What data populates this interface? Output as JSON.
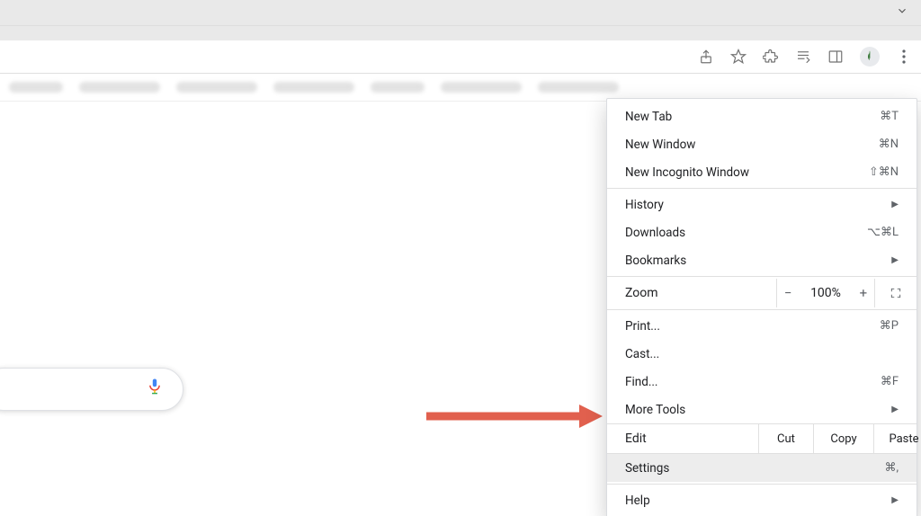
{
  "menu": {
    "newTab": {
      "label": "New Tab",
      "shortcut": "⌘T"
    },
    "newWindow": {
      "label": "New Window",
      "shortcut": "⌘N"
    },
    "newIncognito": {
      "label": "New Incognito Window",
      "shortcut": "⇧⌘N"
    },
    "history": {
      "label": "History"
    },
    "downloads": {
      "label": "Downloads",
      "shortcut": "⌥⌘L"
    },
    "bookmarks": {
      "label": "Bookmarks"
    },
    "zoom": {
      "label": "Zoom",
      "value": "100%"
    },
    "print": {
      "label": "Print...",
      "shortcut": "⌘P"
    },
    "cast": {
      "label": "Cast..."
    },
    "find": {
      "label": "Find...",
      "shortcut": "⌘F"
    },
    "moreTools": {
      "label": "More Tools"
    },
    "edit": {
      "label": "Edit",
      "cut": "Cut",
      "copy": "Copy",
      "paste": "Paste"
    },
    "settings": {
      "label": "Settings",
      "shortcut": "⌘,"
    },
    "help": {
      "label": "Help"
    }
  }
}
